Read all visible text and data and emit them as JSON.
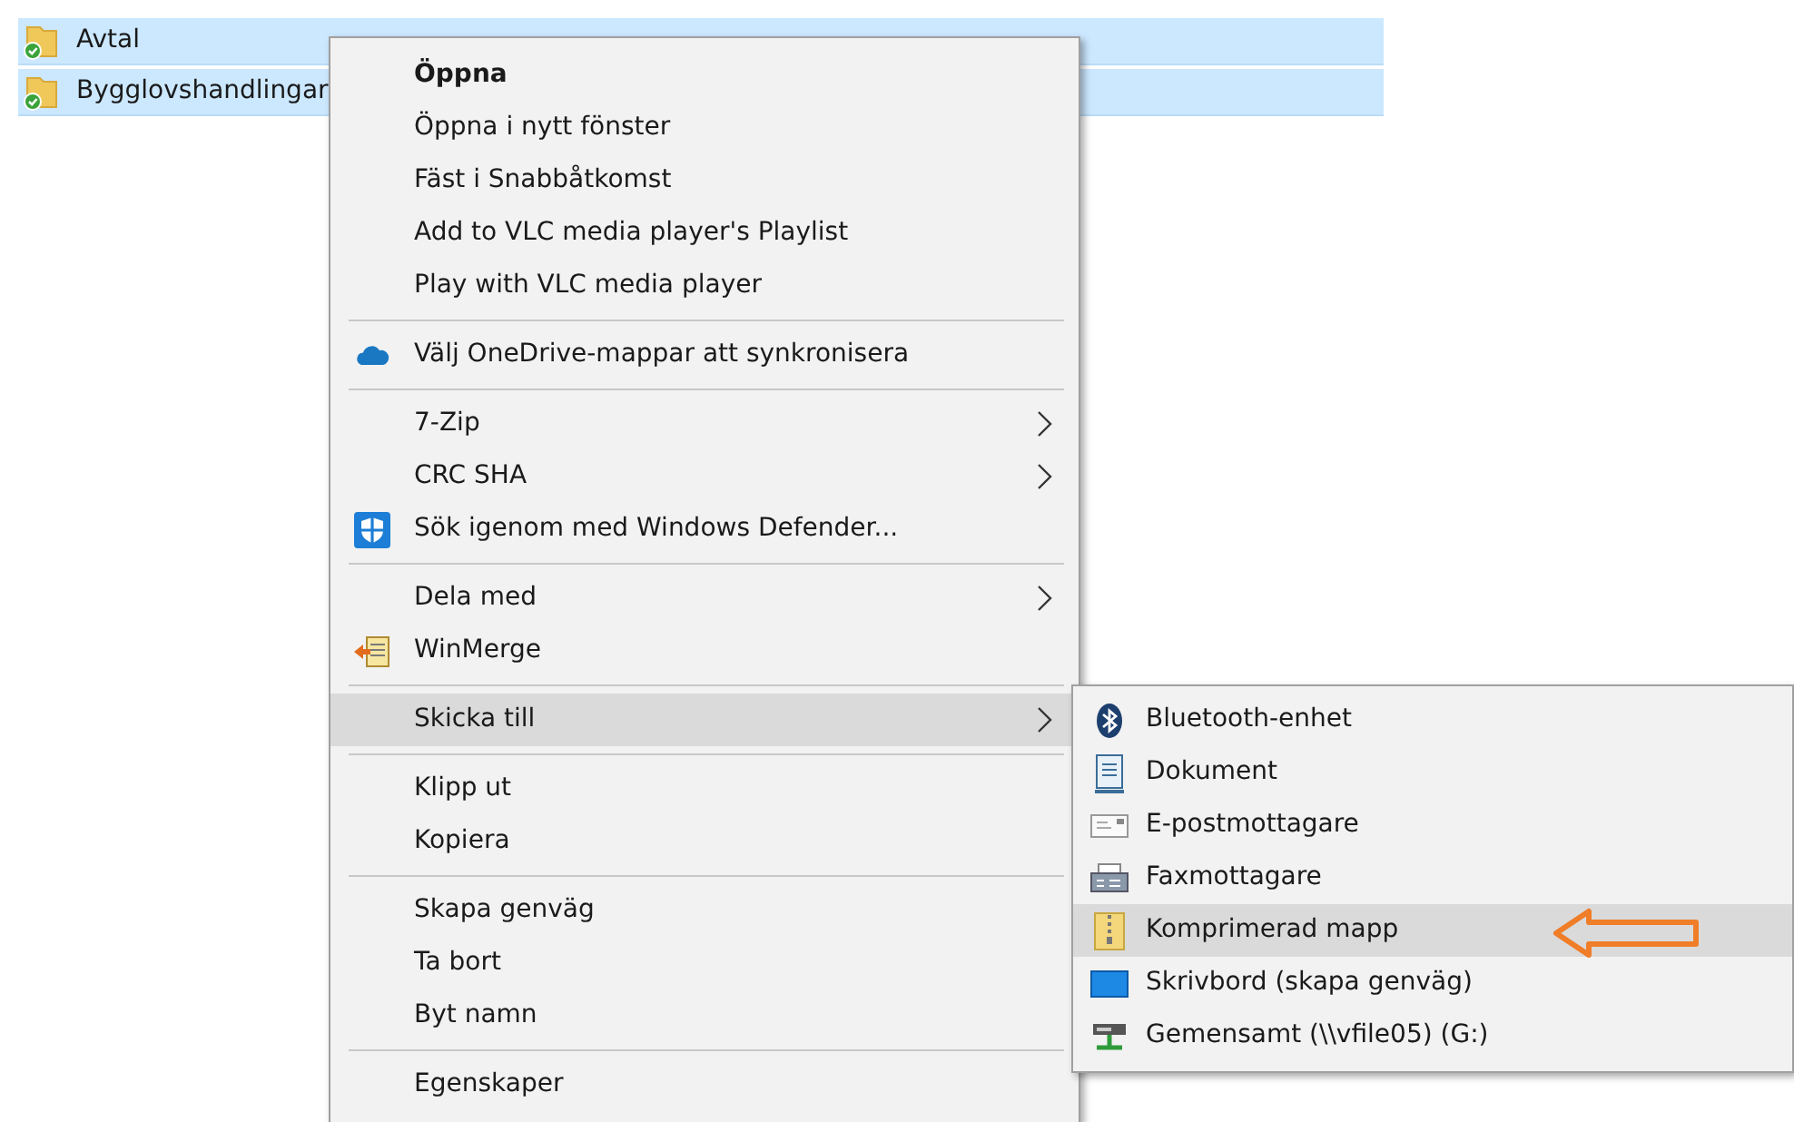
{
  "files": [
    {
      "name": "Avtal",
      "selected": true
    },
    {
      "name": "Bygglovshandlingar",
      "selected": true
    }
  ],
  "context_menu": {
    "items": [
      {
        "kind": "item",
        "label": "Öppna",
        "default": true,
        "submenu": false,
        "selected": false
      },
      {
        "kind": "item",
        "label": "Öppna i nytt fönster",
        "default": false,
        "submenu": false,
        "selected": false
      },
      {
        "kind": "item",
        "label": "Fäst i Snabbåtkomst",
        "default": false,
        "submenu": false,
        "selected": false
      },
      {
        "kind": "item",
        "label": "Add to VLC media player's Playlist",
        "default": false,
        "submenu": false,
        "selected": false
      },
      {
        "kind": "item",
        "label": "Play with VLC media player",
        "default": false,
        "submenu": false,
        "selected": false
      },
      {
        "kind": "separator"
      },
      {
        "kind": "item",
        "label": "Välj OneDrive-mappar att synkronisera",
        "default": false,
        "submenu": false,
        "selected": false
      },
      {
        "kind": "separator"
      },
      {
        "kind": "item",
        "label": "7-Zip",
        "default": false,
        "submenu": true,
        "selected": false
      },
      {
        "kind": "item",
        "label": "CRC SHA",
        "default": false,
        "submenu": true,
        "selected": false
      },
      {
        "kind": "item",
        "label": "Sök igenom med Windows Defender...",
        "default": false,
        "submenu": false,
        "selected": false
      },
      {
        "kind": "separator"
      },
      {
        "kind": "item",
        "label": "Dela med",
        "default": false,
        "submenu": true,
        "selected": false
      },
      {
        "kind": "item",
        "label": "WinMerge",
        "default": false,
        "submenu": false,
        "selected": false
      },
      {
        "kind": "separator"
      },
      {
        "kind": "item",
        "label": "Skicka till",
        "default": false,
        "submenu": true,
        "selected": true
      },
      {
        "kind": "separator"
      },
      {
        "kind": "item",
        "label": "Klipp ut",
        "default": false,
        "submenu": false,
        "selected": false
      },
      {
        "kind": "item",
        "label": "Kopiera",
        "default": false,
        "submenu": false,
        "selected": false
      },
      {
        "kind": "separator"
      },
      {
        "kind": "item",
        "label": "Skapa genväg",
        "default": false,
        "submenu": false,
        "selected": false
      },
      {
        "kind": "item",
        "label": "Ta bort",
        "default": false,
        "submenu": false,
        "selected": false
      },
      {
        "kind": "item",
        "label": "Byt namn",
        "default": false,
        "submenu": false,
        "selected": false
      },
      {
        "kind": "separator"
      },
      {
        "kind": "item",
        "label": "Egenskaper",
        "default": false,
        "submenu": false,
        "selected": false
      }
    ]
  },
  "send_to_menu": {
    "items": [
      {
        "label": "Bluetooth-enhet",
        "selected": false
      },
      {
        "label": "Dokument",
        "selected": false
      },
      {
        "label": "E-postmottagare",
        "selected": false
      },
      {
        "label": "Faxmottagare",
        "selected": false
      },
      {
        "label": "Komprimerad mapp",
        "selected": true
      },
      {
        "label": "Skrivbord (skapa genväg)",
        "selected": false
      },
      {
        "label": "Gemensamt (\\\\vfile05) (G:)",
        "selected": false
      }
    ]
  }
}
